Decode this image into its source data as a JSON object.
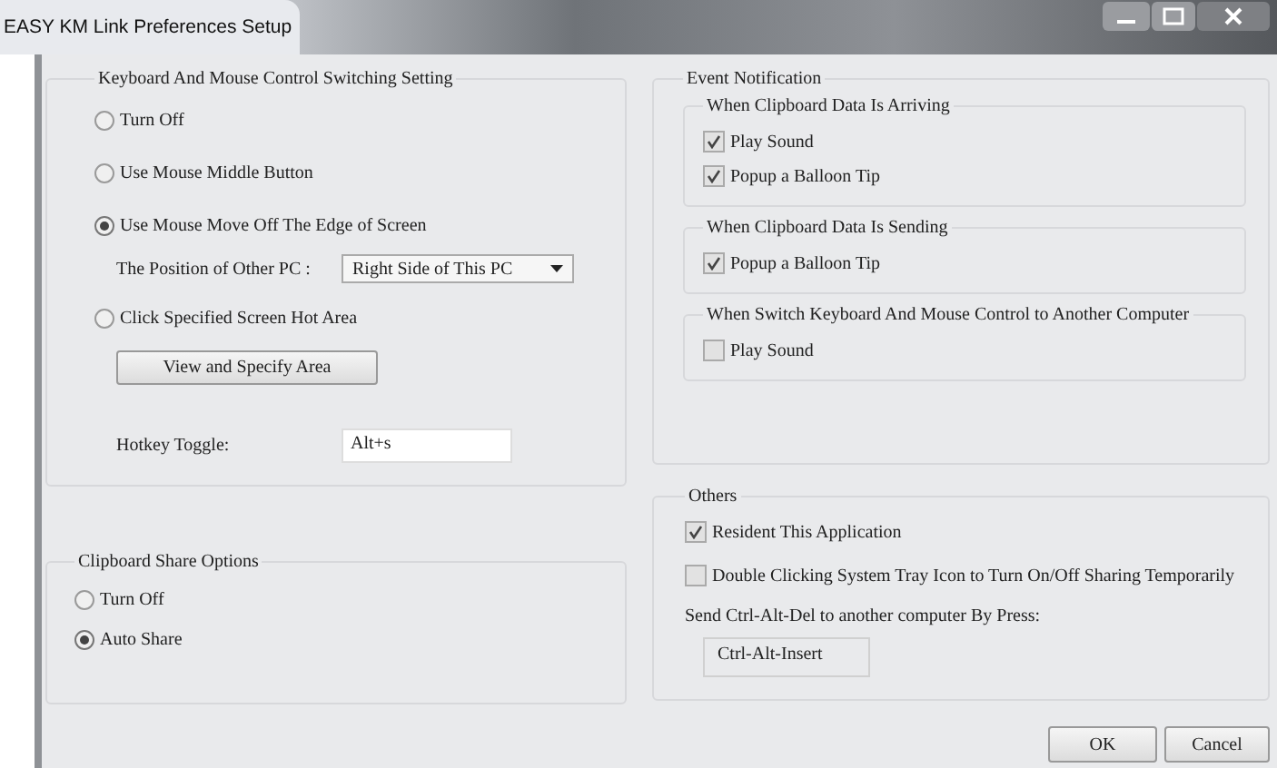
{
  "window": {
    "title": "EASY KM Link Preferences Setup"
  },
  "keyboard_mouse": {
    "title": "Keyboard And Mouse Control Switching Setting",
    "options": [
      {
        "label": "Turn Off",
        "selected": false
      },
      {
        "label": "Use Mouse Middle Button",
        "selected": false
      },
      {
        "label": "Use Mouse Move Off The Edge of Screen",
        "selected": true
      },
      {
        "label": "Click Specified Screen Hot Area",
        "selected": false
      }
    ],
    "position_label": "The Position of Other PC :",
    "position_value": "Right Side of This PC",
    "view_button": "View and Specify Area",
    "hotkey_label": "Hotkey Toggle:",
    "hotkey_value": "Alt+s"
  },
  "clipboard": {
    "title": "Clipboard Share Options",
    "options": [
      {
        "label": "Turn Off",
        "selected": false
      },
      {
        "label": "Auto Share",
        "selected": true
      }
    ]
  },
  "event_notification": {
    "title": "Event Notification",
    "groups": [
      {
        "title": "When Clipboard Data Is Arriving",
        "items": [
          {
            "label": "Play Sound",
            "checked": true
          },
          {
            "label": "Popup a Balloon Tip",
            "checked": true
          }
        ]
      },
      {
        "title": "When Clipboard Data Is Sending",
        "items": [
          {
            "label": "Popup a Balloon Tip",
            "checked": true
          }
        ]
      },
      {
        "title": "When Switch Keyboard And Mouse Control to Another Computer",
        "items": [
          {
            "label": "Play Sound",
            "checked": false
          }
        ]
      }
    ]
  },
  "others": {
    "title": "Others",
    "items": [
      {
        "label": "Resident This Application",
        "checked": true
      },
      {
        "label": "Double Clicking System Tray Icon to Turn On/Off Sharing Temporarily",
        "checked": false
      }
    ],
    "send_label": "Send Ctrl-Alt-Del to another computer By Press:",
    "send_value": "Ctrl-Alt-Insert"
  },
  "buttons": [
    "OK",
    "Cancel"
  ]
}
